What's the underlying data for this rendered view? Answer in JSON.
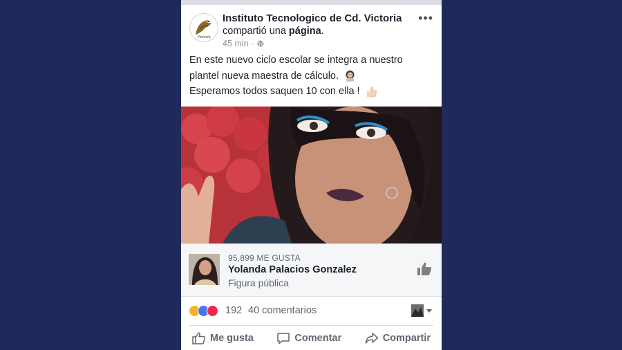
{
  "post": {
    "author": "Instituto Tecnologico de Cd. Victoria",
    "shared_prefix": "compartió una",
    "shared_object": "página",
    "time": "45 min",
    "dot": "·",
    "text_lines": [
      "En este nuevo ciclo escolar se integra a nuestro",
      "plantel nueva maestra de cálculo.",
      "Esperamos todos saquen 10 con ella !"
    ]
  },
  "attachment": {
    "likes": "95,899 ME GUSTA",
    "page_name": "Yolanda Palacios Gonzalez",
    "category": "Figura pública"
  },
  "reactions": {
    "count": "192",
    "comments": "40 comentarios",
    "icons": [
      "haha-icon",
      "like-icon",
      "love-icon"
    ],
    "colors": {
      "haha": "#f7b125",
      "like": "#4a76e8",
      "love": "#ed2a4c"
    }
  },
  "actions": {
    "like": "Me gusta",
    "comment": "Comentar",
    "share": "Compartir"
  },
  "logo_text": "Victoria"
}
